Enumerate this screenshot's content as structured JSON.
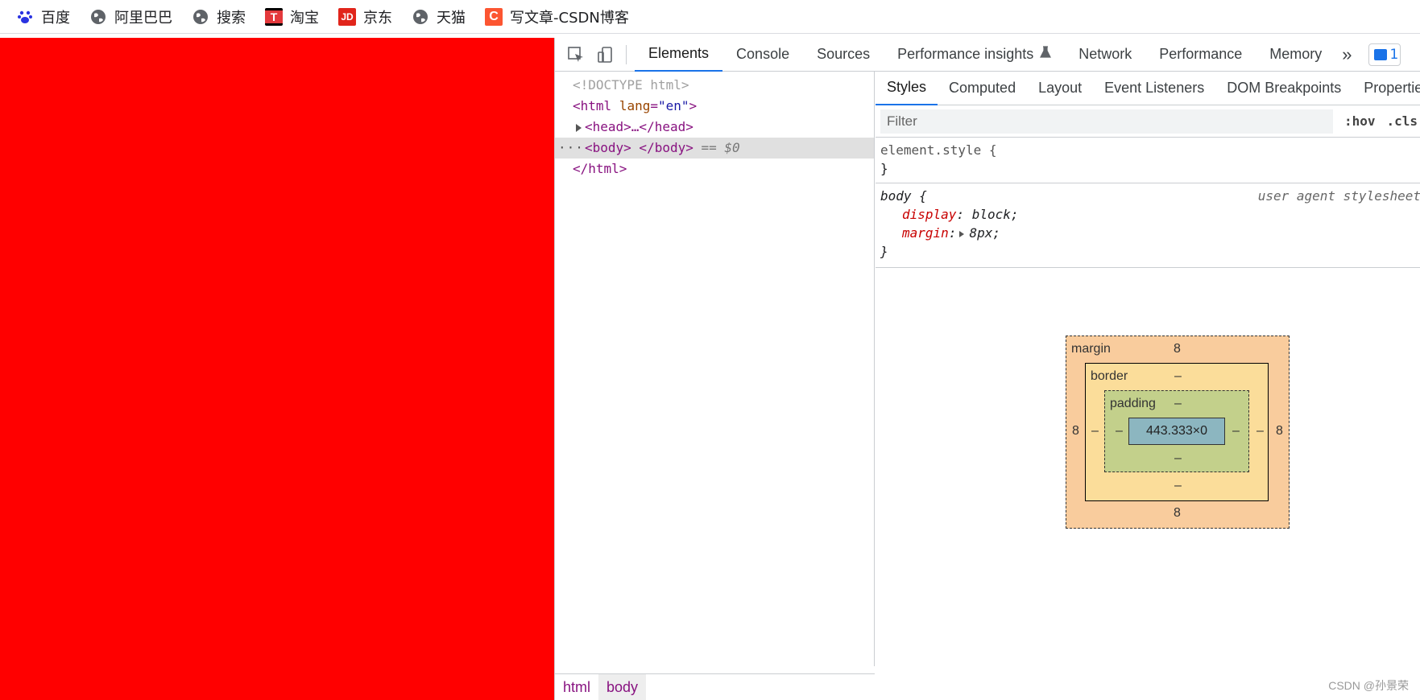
{
  "bookmarks": [
    {
      "label": "百度",
      "icon": "baidu-paw-icon",
      "color": "#2932e1"
    },
    {
      "label": "阿里巴巴",
      "icon": "globe-icon",
      "color": "#5f6368"
    },
    {
      "label": "搜索",
      "icon": "globe-icon",
      "color": "#5f6368"
    },
    {
      "label": "淘宝",
      "icon": "taobao-icon",
      "color": "#e4393c",
      "glyph": "T"
    },
    {
      "label": "京东",
      "icon": "jd-icon",
      "color": "#e1251b",
      "glyph": "JD"
    },
    {
      "label": "天猫",
      "icon": "globe-icon",
      "color": "#5f6368"
    },
    {
      "label": "写文章-CSDN博客",
      "icon": "csdn-icon",
      "color": "#fc5531",
      "glyph": "C"
    }
  ],
  "viewport": {
    "background": "#ff0000"
  },
  "devtools": {
    "tabs": [
      "Elements",
      "Console",
      "Sources",
      "Performance insights",
      "Network",
      "Performance",
      "Memory"
    ],
    "active_tab": "Elements",
    "more_tabs_glyph": "»",
    "issues_count": "1",
    "dom": {
      "doctype": "<!DOCTYPE html>",
      "html_open_tag": "<html",
      "html_attr_name": "lang",
      "html_attr_value": "\"en\"",
      "html_open_end": ">",
      "head_collapsed": "<head>…</head>",
      "body_line": "<body> </body>",
      "body_eq": "== $0",
      "html_close": "</html>",
      "dots": "···"
    },
    "breadcrumb": [
      "html",
      "body"
    ],
    "styles": {
      "sub_tabs": [
        "Styles",
        "Computed",
        "Layout",
        "Event Listeners",
        "DOM Breakpoints",
        "Properties"
      ],
      "active_sub_tab": "Styles",
      "filter_placeholder": "Filter",
      "hov": ":hov",
      "cls": ".cls",
      "element_style": {
        "selector": "element.style {",
        "close": "}"
      },
      "body_rule": {
        "selector": "body {",
        "source": "user agent stylesheet",
        "props": [
          {
            "name": "display",
            "value": "block;"
          },
          {
            "name": "margin",
            "value": "8px;"
          }
        ],
        "close": "}"
      }
    },
    "box_model": {
      "margin_label": "margin",
      "margin_top": "8",
      "margin_bottom": "8",
      "margin_left": "8",
      "margin_right": "8",
      "border_label": "border",
      "border_top": "–",
      "border_bottom": "–",
      "border_left": "–",
      "border_right": "–",
      "padding_label": "padding",
      "padding_top": "–",
      "padding_bottom": "–",
      "padding_left": "–",
      "padding_right": "–",
      "content": "443.333×0"
    }
  },
  "watermark": "CSDN @孙景荣"
}
